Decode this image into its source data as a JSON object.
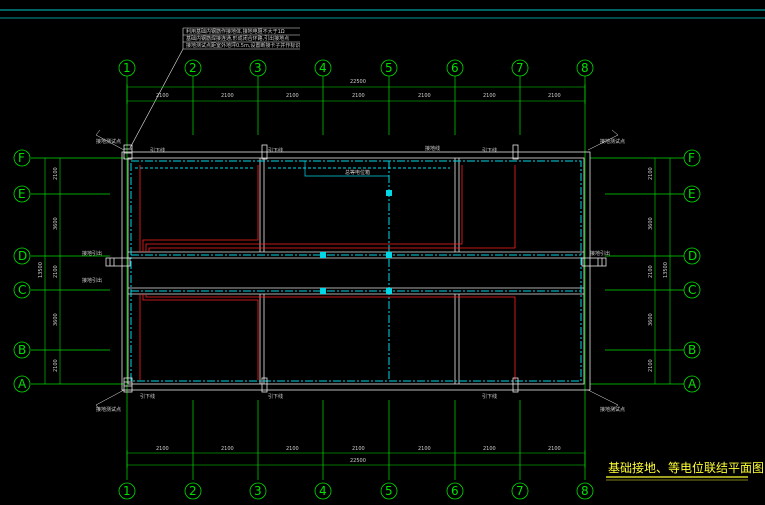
{
  "drawing": {
    "title": "基础接地、等电位联结平面图",
    "top_col_axes": [
      "1",
      "2",
      "3",
      "4",
      "5",
      "6",
      "7",
      "8"
    ],
    "bottom_col_axes": [
      "1",
      "2",
      "3",
      "4",
      "5",
      "6",
      "7",
      "8"
    ],
    "left_row_axes": [
      "F",
      "E",
      "D",
      "C",
      "B",
      "A"
    ],
    "right_row_axes": [
      "F",
      "E",
      "D",
      "C",
      "B",
      "A"
    ],
    "top_bay_dims": [
      "2100",
      "2100",
      "2100",
      "2100",
      "2100",
      "2100",
      "2100"
    ],
    "bottom_bay_dims": [
      "2100",
      "2100",
      "2100",
      "2100",
      "2100",
      "2100",
      "2100"
    ],
    "top_total_dim": "22500",
    "bottom_total_dim": "22500",
    "left_row_dims": [
      "2100",
      "3600",
      "2100",
      "3600",
      "2100"
    ],
    "right_row_dims": [
      "2100",
      "3600",
      "2100",
      "3600",
      "2100"
    ],
    "left_total_dim": "13500",
    "right_total_dim": "13500",
    "note_lines": [
      "利用基础内钢筋作接地体,接地电阻不大于1Ω",
      "基础内钢筋焊接连通,形成闭合环路,引出接地点",
      "接地测试点距室外地坪0.5m,设置断接卡子并作标识"
    ],
    "callouts": {
      "test_point_tl": "接地测试点",
      "test_point_bl": "接地测试点",
      "test_point_br": "接地测试点",
      "test_point_tr": "接地测试点",
      "downlead_1": "引下线",
      "downlead_2": "引下线",
      "downlead_3": "引下线",
      "downlead_4": "引下线",
      "downlead_5": "引下线",
      "downlead_6": "引下线",
      "downlead_7": "引下线",
      "equip": "总等电位箱",
      "ring": "接地线",
      "ext_left": "接地引出",
      "ext_right": "接地引出",
      "ext_left2": "接地引出"
    }
  },
  "colors": {
    "axis_green": "#00e000",
    "structure_white": "#e6e6e6",
    "grounding_cyan": "#00d8e8",
    "bonding_red": "#ff2020",
    "title_yellow": "#ffff33",
    "frame_cyan": "#00c8c8"
  }
}
